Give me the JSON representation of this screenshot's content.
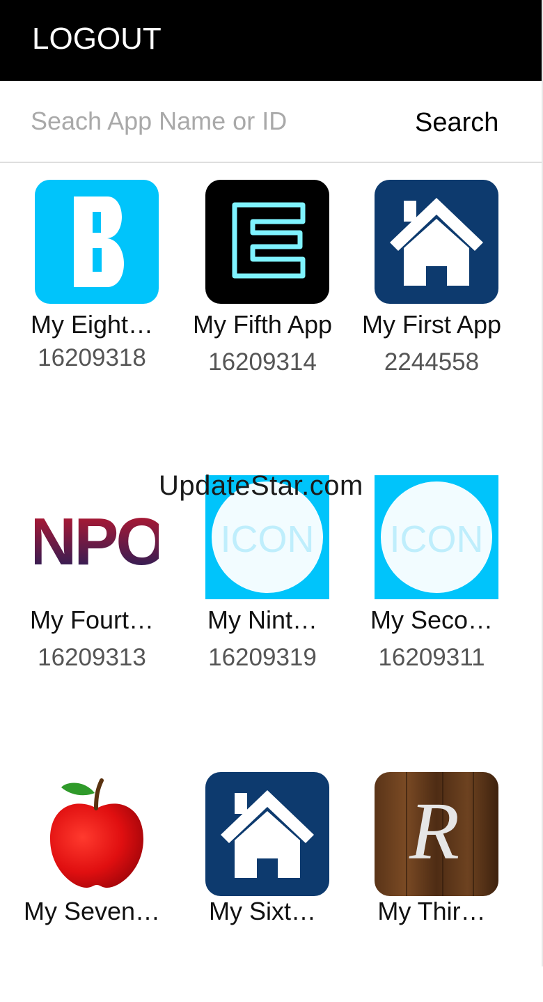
{
  "header": {
    "logout_label": "LOGOUT"
  },
  "search": {
    "placeholder": "Seach App Name or ID",
    "button_label": "Search"
  },
  "apps": [
    {
      "name": "My Eight…",
      "id": "16209318",
      "icon": "letter-b-icon"
    },
    {
      "name": "My Fifth App",
      "id": "16209314",
      "icon": "neon-e-icon"
    },
    {
      "name": "My First App",
      "id": "2244558",
      "icon": "house-icon"
    },
    {
      "name": "My Fourt…",
      "id": "16209313",
      "icon": "npo-logo-icon"
    },
    {
      "name": "My Nint…",
      "id": "16209319",
      "icon": "icon-placeholder-icon"
    },
    {
      "name": "My Seco…",
      "id": "16209311",
      "icon": "icon-placeholder-icon"
    },
    {
      "name": "My Seven…",
      "id": "",
      "icon": "apple-icon"
    },
    {
      "name": "My Sixt…",
      "id": "",
      "icon": "house-icon"
    },
    {
      "name": "My Thir…",
      "id": "",
      "icon": "script-r-icon"
    }
  ],
  "icon_text": {
    "npo": "NPO",
    "placeholder": "ICON",
    "r": "R"
  },
  "watermark": "UpdateStar.com",
  "colors": {
    "header_bg": "#000000",
    "sky_blue": "#00c4fb",
    "navy": "#0d3a6e",
    "neon": "#7ff3ff"
  }
}
